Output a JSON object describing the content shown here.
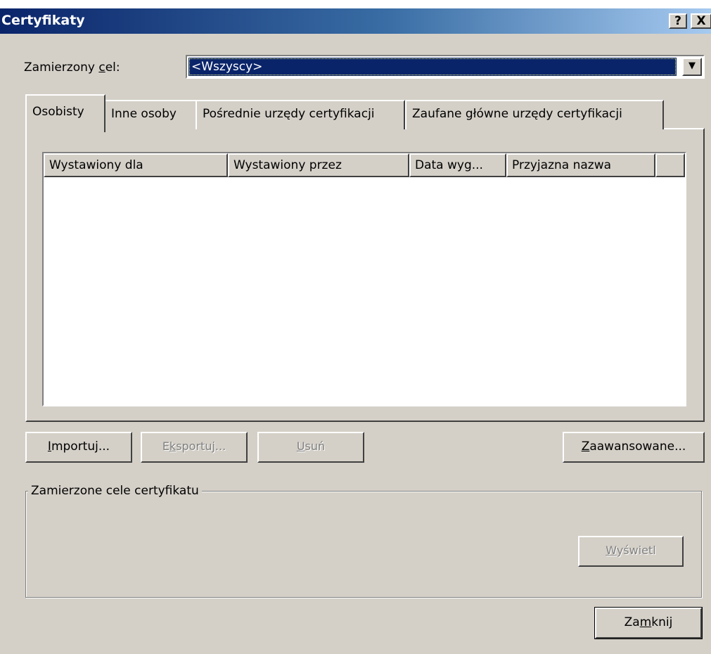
{
  "window": {
    "title": "Certyfikaty",
    "help_glyph": "?",
    "close_glyph": "X"
  },
  "purpose": {
    "label_prefix": "Zamierzony ",
    "label_underlined": "c",
    "label_suffix": "el:",
    "selected_value": "<Wszyscy>",
    "arrow_glyph": "▼"
  },
  "tabs": [
    {
      "label": "Osobisty",
      "active": true
    },
    {
      "label": "Inne osoby",
      "active": false
    },
    {
      "label": "Pośrednie urzędy certyfikacji",
      "active": false
    },
    {
      "label": "Zaufane główne urzędy certyfikacji",
      "active": false
    }
  ],
  "list": {
    "columns": [
      "Wystawiony dla",
      "Wystawiony przez",
      "Data wyg...",
      "Przyjazna nazwa"
    ],
    "rows": []
  },
  "buttons": {
    "import": {
      "u": "I",
      "rest": "mportuj..."
    },
    "export": {
      "pre": "E",
      "u": "k",
      "rest": "sportuj..."
    },
    "remove": {
      "u": "U",
      "rest": "suń"
    },
    "advanced": {
      "u": "Z",
      "rest": "aawansowane..."
    },
    "view": {
      "u": "W",
      "rest": "yświetl"
    },
    "close": {
      "pre": "Za",
      "u": "m",
      "rest": "knij"
    }
  },
  "purposes_group": {
    "title": "Zamierzone cele certyfikatu"
  },
  "colors": {
    "face": "#d4d0c8",
    "title_start": "#0a246a",
    "title_end": "#a6caf0",
    "selection": "#0a246a"
  }
}
